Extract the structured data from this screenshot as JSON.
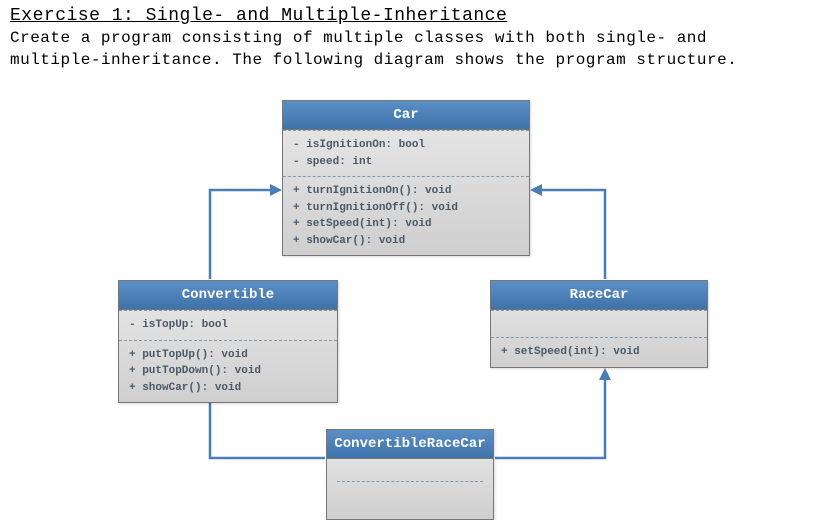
{
  "heading": "Exercise 1: Single- and Multiple-Inheritance",
  "description": "Create a program consisting of multiple classes with both single- and multiple-inheritance. The following diagram shows the program structure.",
  "colors": {
    "header_bg": "#4a7cb5",
    "body_bg": "#d9d9d9",
    "arrow": "#4a7cb5",
    "text_muted": "#4a5968"
  },
  "classes": {
    "car": {
      "name": "Car",
      "attributes": [
        "- isIgnitionOn: bool",
        "- speed: int"
      ],
      "methods": [
        "+ turnIgnitionOn(): void",
        "+ turnIgnitionOff(): void",
        "+ setSpeed(int): void",
        "+ showCar(): void"
      ]
    },
    "convertible": {
      "name": "Convertible",
      "attributes": [
        "- isTopUp: bool"
      ],
      "methods": [
        "+ putTopUp(): void",
        "+ putTopDown(): void",
        "+ showCar(): void"
      ]
    },
    "racecar": {
      "name": "RaceCar",
      "attributes": [],
      "methods": [
        "+ setSpeed(int): void"
      ]
    },
    "convertibleracecar": {
      "name": "ConvertibleRaceCar",
      "attributes": [],
      "methods": []
    }
  },
  "relations": [
    {
      "from": "Convertible",
      "to": "Car",
      "type": "inherits"
    },
    {
      "from": "RaceCar",
      "to": "Car",
      "type": "inherits"
    },
    {
      "from": "ConvertibleRaceCar",
      "to": "Convertible",
      "type": "inherits"
    },
    {
      "from": "ConvertibleRaceCar",
      "to": "RaceCar",
      "type": "inherits"
    }
  ]
}
